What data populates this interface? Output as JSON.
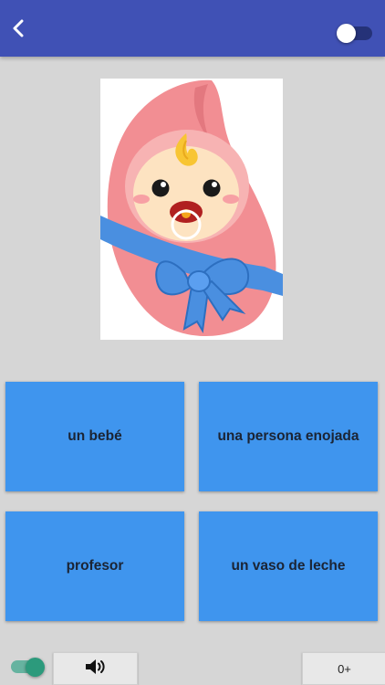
{
  "header": {
    "back_icon": "chevron-left-icon",
    "mode_toggle_on": false
  },
  "picture": {
    "icon": "swaddled-baby-icon"
  },
  "answers": [
    {
      "label": "un bebé"
    },
    {
      "label": "una persona enojada"
    },
    {
      "label": "profesor"
    },
    {
      "label": "un vaso de leche"
    }
  ],
  "footer": {
    "toggle_on": true,
    "sound_icon": "speaker-volume-icon",
    "score": "0+"
  },
  "colors": {
    "appbar": "#4051b5",
    "answer_button": "#3f95ee",
    "background": "#d6d6d6",
    "footer_toggle": "#2c9a7c"
  }
}
